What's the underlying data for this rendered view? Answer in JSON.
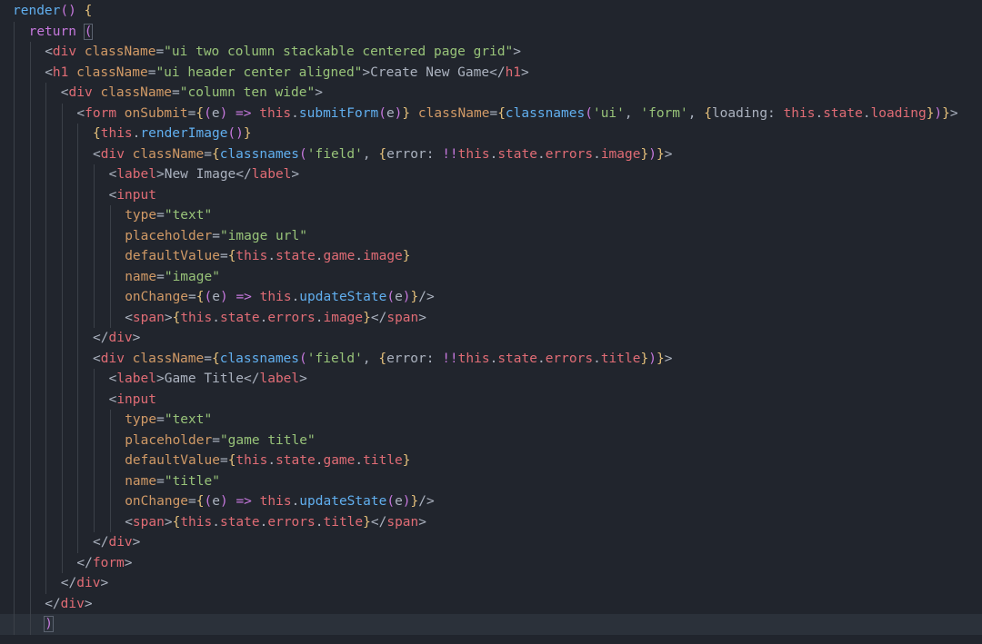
{
  "editor": {
    "current_line": 30,
    "lines": [
      {
        "indent": 0,
        "tokens": [
          [
            "fn",
            "render"
          ],
          [
            "paren",
            "()"
          ],
          [
            "pl",
            " "
          ],
          [
            "brace",
            "{"
          ]
        ]
      },
      {
        "indent": 1,
        "tokens": [
          [
            "kw",
            "return"
          ],
          [
            "pl",
            " "
          ],
          [
            "paren-hl",
            "("
          ]
        ]
      },
      {
        "indent": 2,
        "tokens": [
          [
            "pl",
            "<"
          ],
          [
            "tag",
            "div"
          ],
          [
            "pl",
            " "
          ],
          [
            "attr",
            "className"
          ],
          [
            "pl",
            "="
          ],
          [
            "str",
            "\"ui two column stackable centered page grid\""
          ],
          [
            "pl",
            ">"
          ]
        ]
      },
      {
        "indent": 2,
        "tokens": [
          [
            "pl",
            "<"
          ],
          [
            "tag",
            "h1"
          ],
          [
            "pl",
            " "
          ],
          [
            "attr",
            "className"
          ],
          [
            "pl",
            "="
          ],
          [
            "str",
            "\"ui header center aligned\""
          ],
          [
            "pl",
            ">Create New Game</"
          ],
          [
            "tag",
            "h1"
          ],
          [
            "pl",
            ">"
          ]
        ]
      },
      {
        "indent": 3,
        "tokens": [
          [
            "pl",
            "<"
          ],
          [
            "tag",
            "div"
          ],
          [
            "pl",
            " "
          ],
          [
            "attr",
            "className"
          ],
          [
            "pl",
            "="
          ],
          [
            "str",
            "\"column ten wide\""
          ],
          [
            "pl",
            ">"
          ]
        ]
      },
      {
        "indent": 4,
        "tokens": [
          [
            "pl",
            "<"
          ],
          [
            "tag",
            "form"
          ],
          [
            "pl",
            " "
          ],
          [
            "attr",
            "onSubmit"
          ],
          [
            "pl",
            "="
          ],
          [
            "brace",
            "{"
          ],
          [
            "paren",
            "("
          ],
          [
            "pl",
            "e"
          ],
          [
            "paren",
            ")"
          ],
          [
            "pl",
            " "
          ],
          [
            "op",
            "=>"
          ],
          [
            "pl",
            " "
          ],
          [
            "this",
            "this"
          ],
          [
            "pl",
            "."
          ],
          [
            "meth",
            "submitForm"
          ],
          [
            "paren",
            "("
          ],
          [
            "pl",
            "e"
          ],
          [
            "paren",
            ")"
          ],
          [
            "brace",
            "}"
          ],
          [
            "pl",
            " "
          ],
          [
            "attr",
            "className"
          ],
          [
            "pl",
            "="
          ],
          [
            "brace",
            "{"
          ],
          [
            "meth",
            "classnames"
          ],
          [
            "paren",
            "("
          ],
          [
            "str",
            "'ui'"
          ],
          [
            "pl",
            ", "
          ],
          [
            "str",
            "'form'"
          ],
          [
            "pl",
            ", "
          ],
          [
            "brace",
            "{"
          ],
          [
            "pl",
            "loading: "
          ],
          [
            "this",
            "this"
          ],
          [
            "pl",
            "."
          ],
          [
            "prop",
            "state"
          ],
          [
            "pl",
            "."
          ],
          [
            "prop",
            "loading"
          ],
          [
            "brace",
            "}"
          ],
          [
            "paren",
            ")"
          ],
          [
            "brace",
            "}"
          ],
          [
            "pl",
            ">"
          ]
        ]
      },
      {
        "indent": 5,
        "tokens": [
          [
            "brace",
            "{"
          ],
          [
            "this",
            "this"
          ],
          [
            "pl",
            "."
          ],
          [
            "meth",
            "renderImage"
          ],
          [
            "paren",
            "()"
          ],
          [
            "brace",
            "}"
          ]
        ]
      },
      {
        "indent": 5,
        "tokens": [
          [
            "pl",
            "<"
          ],
          [
            "tag",
            "div"
          ],
          [
            "pl",
            " "
          ],
          [
            "attr",
            "className"
          ],
          [
            "pl",
            "="
          ],
          [
            "brace",
            "{"
          ],
          [
            "meth",
            "classnames"
          ],
          [
            "paren",
            "("
          ],
          [
            "str",
            "'field'"
          ],
          [
            "pl",
            ", "
          ],
          [
            "brace",
            "{"
          ],
          [
            "pl",
            "error: "
          ],
          [
            "op",
            "!!"
          ],
          [
            "this",
            "this"
          ],
          [
            "pl",
            "."
          ],
          [
            "prop",
            "state"
          ],
          [
            "pl",
            "."
          ],
          [
            "prop",
            "errors"
          ],
          [
            "pl",
            "."
          ],
          [
            "prop",
            "image"
          ],
          [
            "brace",
            "}"
          ],
          [
            "paren",
            ")"
          ],
          [
            "brace",
            "}"
          ],
          [
            "pl",
            ">"
          ]
        ]
      },
      {
        "indent": 6,
        "tokens": [
          [
            "pl",
            "<"
          ],
          [
            "tag",
            "label"
          ],
          [
            "pl",
            ">New Image</"
          ],
          [
            "tag",
            "label"
          ],
          [
            "pl",
            ">"
          ]
        ]
      },
      {
        "indent": 6,
        "tokens": [
          [
            "pl",
            "<"
          ],
          [
            "tag",
            "input"
          ]
        ]
      },
      {
        "indent": 7,
        "tokens": [
          [
            "attr",
            "type"
          ],
          [
            "pl",
            "="
          ],
          [
            "str",
            "\"text\""
          ]
        ]
      },
      {
        "indent": 7,
        "tokens": [
          [
            "attr",
            "placeholder"
          ],
          [
            "pl",
            "="
          ],
          [
            "str",
            "\"image url\""
          ]
        ]
      },
      {
        "indent": 7,
        "tokens": [
          [
            "attr",
            "defaultValue"
          ],
          [
            "pl",
            "="
          ],
          [
            "brace",
            "{"
          ],
          [
            "this",
            "this"
          ],
          [
            "pl",
            "."
          ],
          [
            "prop",
            "state"
          ],
          [
            "pl",
            "."
          ],
          [
            "prop",
            "game"
          ],
          [
            "pl",
            "."
          ],
          [
            "prop",
            "image"
          ],
          [
            "brace",
            "}"
          ]
        ]
      },
      {
        "indent": 7,
        "tokens": [
          [
            "attr",
            "name"
          ],
          [
            "pl",
            "="
          ],
          [
            "str",
            "\"image\""
          ]
        ]
      },
      {
        "indent": 7,
        "tokens": [
          [
            "attr",
            "onChange"
          ],
          [
            "pl",
            "="
          ],
          [
            "brace",
            "{"
          ],
          [
            "paren",
            "("
          ],
          [
            "pl",
            "e"
          ],
          [
            "paren",
            ")"
          ],
          [
            "pl",
            " "
          ],
          [
            "op",
            "=>"
          ],
          [
            "pl",
            " "
          ],
          [
            "this",
            "this"
          ],
          [
            "pl",
            "."
          ],
          [
            "meth",
            "updateState"
          ],
          [
            "paren",
            "("
          ],
          [
            "pl",
            "e"
          ],
          [
            "paren",
            ")"
          ],
          [
            "brace",
            "}"
          ],
          [
            "pl",
            "/>"
          ]
        ]
      },
      {
        "indent": 7,
        "tokens": [
          [
            "pl",
            "<"
          ],
          [
            "tag",
            "span"
          ],
          [
            "pl",
            ">"
          ],
          [
            "brace",
            "{"
          ],
          [
            "this",
            "this"
          ],
          [
            "pl",
            "."
          ],
          [
            "prop",
            "state"
          ],
          [
            "pl",
            "."
          ],
          [
            "prop",
            "errors"
          ],
          [
            "pl",
            "."
          ],
          [
            "prop",
            "image"
          ],
          [
            "brace",
            "}"
          ],
          [
            "pl",
            "</"
          ],
          [
            "tag",
            "span"
          ],
          [
            "pl",
            ">"
          ]
        ]
      },
      {
        "indent": 5,
        "tokens": [
          [
            "pl",
            "</"
          ],
          [
            "tag",
            "div"
          ],
          [
            "pl",
            ">"
          ]
        ]
      },
      {
        "indent": 5,
        "tokens": [
          [
            "pl",
            "<"
          ],
          [
            "tag",
            "div"
          ],
          [
            "pl",
            " "
          ],
          [
            "attr",
            "className"
          ],
          [
            "pl",
            "="
          ],
          [
            "brace",
            "{"
          ],
          [
            "meth",
            "classnames"
          ],
          [
            "paren",
            "("
          ],
          [
            "str",
            "'field'"
          ],
          [
            "pl",
            ", "
          ],
          [
            "brace",
            "{"
          ],
          [
            "pl",
            "error: "
          ],
          [
            "op",
            "!!"
          ],
          [
            "this",
            "this"
          ],
          [
            "pl",
            "."
          ],
          [
            "prop",
            "state"
          ],
          [
            "pl",
            "."
          ],
          [
            "prop",
            "errors"
          ],
          [
            "pl",
            "."
          ],
          [
            "prop",
            "title"
          ],
          [
            "brace",
            "}"
          ],
          [
            "paren",
            ")"
          ],
          [
            "brace",
            "}"
          ],
          [
            "pl",
            ">"
          ]
        ]
      },
      {
        "indent": 6,
        "tokens": [
          [
            "pl",
            "<"
          ],
          [
            "tag",
            "label"
          ],
          [
            "pl",
            ">Game Title</"
          ],
          [
            "tag",
            "label"
          ],
          [
            "pl",
            ">"
          ]
        ]
      },
      {
        "indent": 6,
        "tokens": [
          [
            "pl",
            "<"
          ],
          [
            "tag",
            "input"
          ]
        ]
      },
      {
        "indent": 7,
        "tokens": [
          [
            "attr",
            "type"
          ],
          [
            "pl",
            "="
          ],
          [
            "str",
            "\"text\""
          ]
        ]
      },
      {
        "indent": 7,
        "tokens": [
          [
            "attr",
            "placeholder"
          ],
          [
            "pl",
            "="
          ],
          [
            "str",
            "\"game title\""
          ]
        ]
      },
      {
        "indent": 7,
        "tokens": [
          [
            "attr",
            "defaultValue"
          ],
          [
            "pl",
            "="
          ],
          [
            "brace",
            "{"
          ],
          [
            "this",
            "this"
          ],
          [
            "pl",
            "."
          ],
          [
            "prop",
            "state"
          ],
          [
            "pl",
            "."
          ],
          [
            "prop",
            "game"
          ],
          [
            "pl",
            "."
          ],
          [
            "prop",
            "title"
          ],
          [
            "brace",
            "}"
          ]
        ]
      },
      {
        "indent": 7,
        "tokens": [
          [
            "attr",
            "name"
          ],
          [
            "pl",
            "="
          ],
          [
            "str",
            "\"title\""
          ]
        ]
      },
      {
        "indent": 7,
        "tokens": [
          [
            "attr",
            "onChange"
          ],
          [
            "pl",
            "="
          ],
          [
            "brace",
            "{"
          ],
          [
            "paren",
            "("
          ],
          [
            "pl",
            "e"
          ],
          [
            "paren",
            ")"
          ],
          [
            "pl",
            " "
          ],
          [
            "op",
            "=>"
          ],
          [
            "pl",
            " "
          ],
          [
            "this",
            "this"
          ],
          [
            "pl",
            "."
          ],
          [
            "meth",
            "updateState"
          ],
          [
            "paren",
            "("
          ],
          [
            "pl",
            "e"
          ],
          [
            "paren",
            ")"
          ],
          [
            "brace",
            "}"
          ],
          [
            "pl",
            "/>"
          ]
        ]
      },
      {
        "indent": 7,
        "tokens": [
          [
            "pl",
            "<"
          ],
          [
            "tag",
            "span"
          ],
          [
            "pl",
            ">"
          ],
          [
            "brace",
            "{"
          ],
          [
            "this",
            "this"
          ],
          [
            "pl",
            "."
          ],
          [
            "prop",
            "state"
          ],
          [
            "pl",
            "."
          ],
          [
            "prop",
            "errors"
          ],
          [
            "pl",
            "."
          ],
          [
            "prop",
            "title"
          ],
          [
            "brace",
            "}"
          ],
          [
            "pl",
            "</"
          ],
          [
            "tag",
            "span"
          ],
          [
            "pl",
            ">"
          ]
        ]
      },
      {
        "indent": 5,
        "tokens": [
          [
            "pl",
            "</"
          ],
          [
            "tag",
            "div"
          ],
          [
            "pl",
            ">"
          ]
        ]
      },
      {
        "indent": 4,
        "tokens": [
          [
            "pl",
            "</"
          ],
          [
            "tag",
            "form"
          ],
          [
            "pl",
            ">"
          ]
        ]
      },
      {
        "indent": 3,
        "tokens": [
          [
            "pl",
            "</"
          ],
          [
            "tag",
            "div"
          ],
          [
            "pl",
            ">"
          ]
        ]
      },
      {
        "indent": 2,
        "tokens": [
          [
            "pl",
            "</"
          ],
          [
            "tag",
            "div"
          ],
          [
            "pl",
            ">"
          ]
        ]
      },
      {
        "indent": 2,
        "tokens": [
          [
            "paren-hl",
            ")"
          ]
        ]
      }
    ]
  },
  "colors": {
    "background": "#21252d",
    "current_line": "#2b313a",
    "indent_guide": "#3b4048"
  }
}
